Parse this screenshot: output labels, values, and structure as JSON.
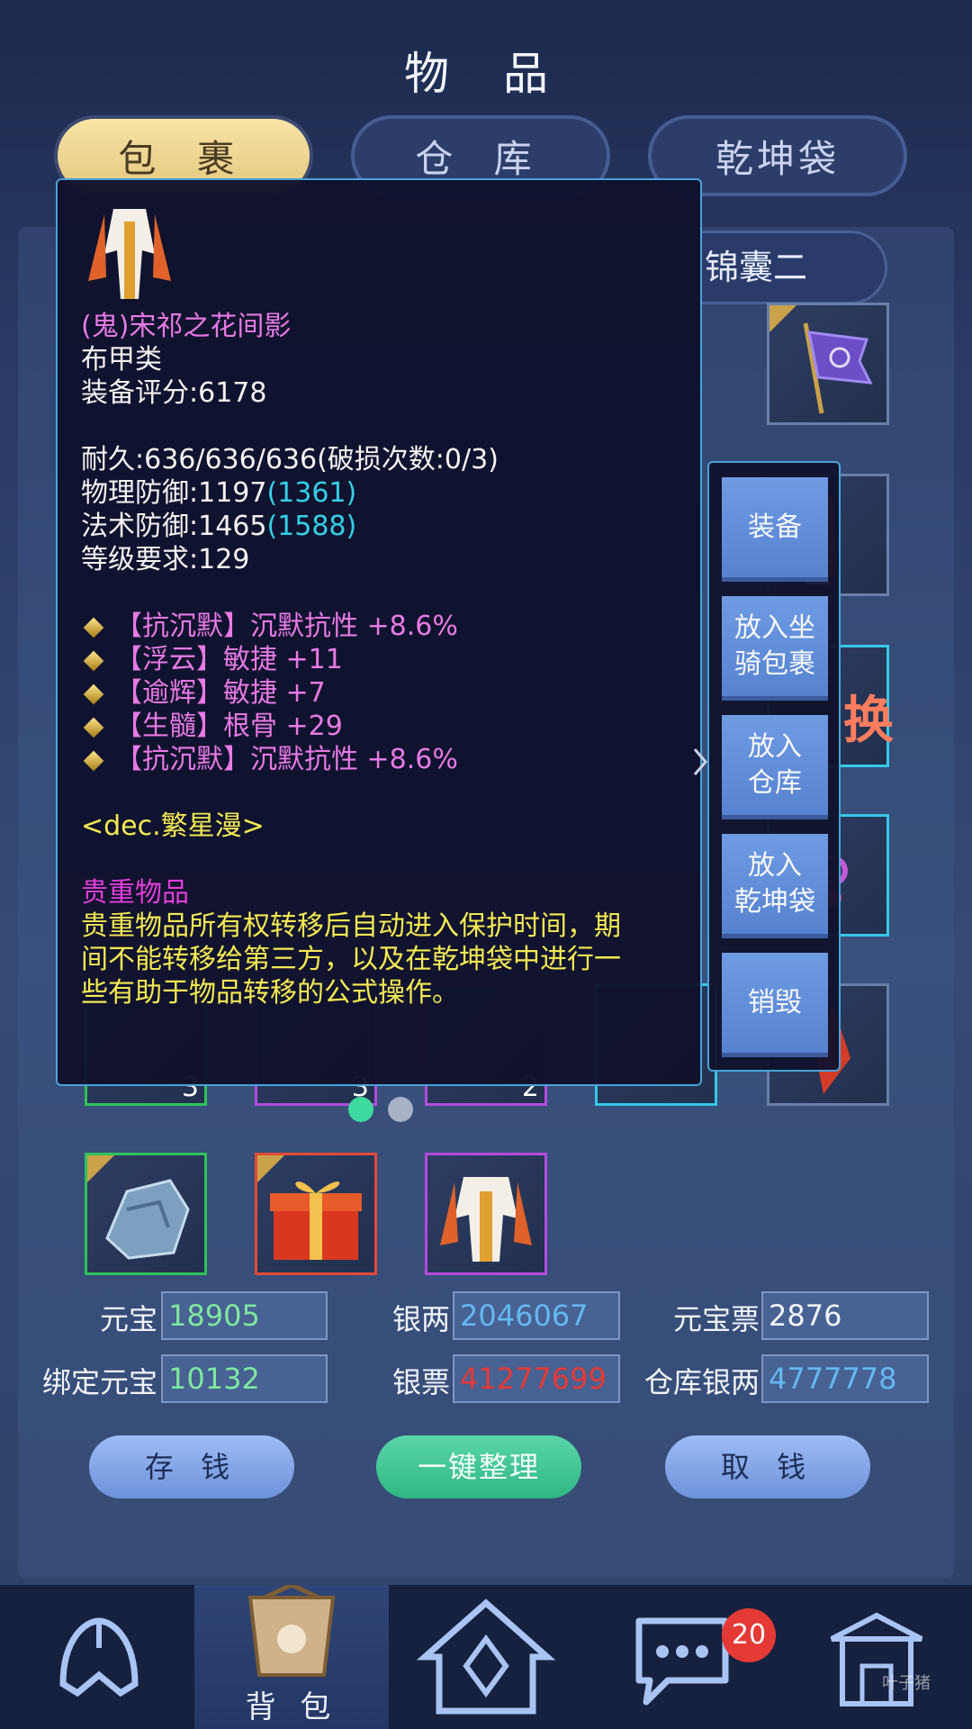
{
  "header": {
    "title": "物 品"
  },
  "tabs": [
    {
      "label": "包 裹",
      "active": true
    },
    {
      "label": "仓 库",
      "active": false
    },
    {
      "label": "乾坤袋",
      "active": false
    }
  ],
  "submenu_label": "锦囊二",
  "partial_slot_text": "换",
  "slot_counts": [
    "3",
    "3",
    "2"
  ],
  "tooltip": {
    "item_name": "(鬼)宋祁之花间影",
    "item_type": "布甲类",
    "score": "装备评分:6178",
    "durability": "耐久:636/636/636(破损次数:0/3)",
    "phys_def": "物理防御:1197",
    "phys_def_bonus": "(1361)",
    "magic_def": "法术防御:1465",
    "magic_def_bonus": "(1588)",
    "level_req": "等级要求:129",
    "attributes": [
      "【抗沉默】沉默抗性 +8.6%",
      "【浮云】敏捷 +11",
      "【逾辉】敏捷 +7",
      "【生髓】根骨 +29",
      "【抗沉默】沉默抗性 +8.6%"
    ],
    "dec": "<dec.繁星漫>",
    "precious_title": "贵重物品",
    "precious_desc_lines": [
      "贵重物品所有权转移后自动进入保护时间，期",
      "间不能转移给第三方，以及在乾坤袋中进行一",
      "些有助于物品转移的公式操作。"
    ]
  },
  "actions": {
    "equip": "装备",
    "mount_bag_1": "放入坐",
    "mount_bag_2": "骑包裹",
    "warehouse_1": "放入",
    "warehouse_2": "仓库",
    "qiankun_1": "放入",
    "qiankun_2": "乾坤袋",
    "destroy": "销毁"
  },
  "currency": {
    "yuanbao_label": "元宝",
    "yuanbao": "18905",
    "silver_label": "银两",
    "silver": "2046067",
    "yuanbao_ticket_label": "元宝票",
    "yuanbao_ticket": "2876",
    "bound_yuanbao_label": "绑定元宝",
    "bound_yuanbao": "10132",
    "silver_ticket_label": "银票",
    "silver_ticket": "41277699",
    "warehouse_silver_label": "仓库银两",
    "warehouse_silver": "4777778"
  },
  "buttons": {
    "deposit": "存 钱",
    "sort": "一键整理",
    "withdraw": "取 钱"
  },
  "bottom_nav": {
    "bag_label": "背 包",
    "chat_badge": "20"
  },
  "colors": {
    "accent_green": "#2fb783",
    "currency_green": "#7fe7a0",
    "currency_blue": "#64b8f0",
    "currency_red": "#e53935"
  }
}
